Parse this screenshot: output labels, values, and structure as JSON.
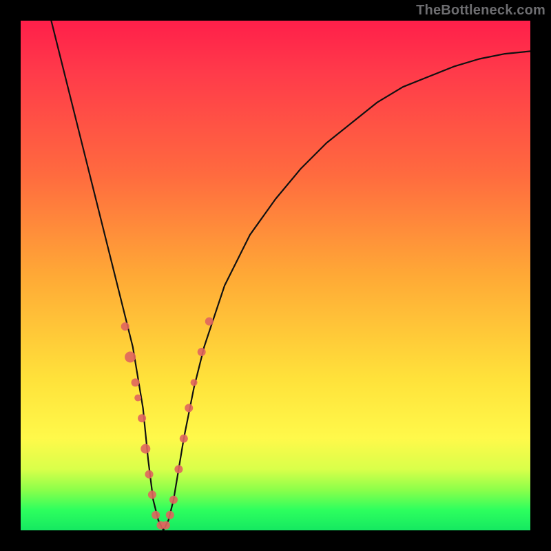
{
  "watermark": "TheBottleneck.com",
  "colors": {
    "gradient_top": "#ff1f4a",
    "gradient_bottom": "#15e861",
    "curve": "#111111",
    "marker": "#e0655e",
    "frame": "#000000"
  },
  "chart_data": {
    "type": "line",
    "title": "",
    "xlabel": "",
    "ylabel": "",
    "xlim": [
      0,
      100
    ],
    "ylim": [
      0,
      100
    ],
    "grid": false,
    "legend": false,
    "series": [
      {
        "name": "curve",
        "x": [
          6,
          8,
          10,
          12,
          14,
          16,
          18,
          20,
          22,
          24,
          25,
          26,
          27,
          28,
          29,
          30,
          32,
          34,
          36,
          40,
          45,
          50,
          55,
          60,
          65,
          70,
          75,
          80,
          85,
          90,
          95,
          100
        ],
        "y": [
          100,
          92,
          84,
          76,
          68,
          60,
          52,
          44,
          36,
          24,
          14,
          6,
          2,
          0,
          2,
          6,
          18,
          28,
          36,
          48,
          58,
          65,
          71,
          76,
          80,
          84,
          87,
          89,
          91,
          92.5,
          93.5,
          94
        ]
      }
    ],
    "markers": [
      {
        "x": 20.5,
        "y": 40,
        "r": 6
      },
      {
        "x": 21.5,
        "y": 34,
        "r": 8
      },
      {
        "x": 22.5,
        "y": 29,
        "r": 6
      },
      {
        "x": 23.0,
        "y": 26,
        "r": 5
      },
      {
        "x": 23.8,
        "y": 22,
        "r": 6
      },
      {
        "x": 24.5,
        "y": 16,
        "r": 7
      },
      {
        "x": 25.2,
        "y": 11,
        "r": 6
      },
      {
        "x": 25.8,
        "y": 7,
        "r": 6
      },
      {
        "x": 26.5,
        "y": 3,
        "r": 6
      },
      {
        "x": 27.5,
        "y": 1,
        "r": 6
      },
      {
        "x": 28.5,
        "y": 1,
        "r": 6
      },
      {
        "x": 29.3,
        "y": 3,
        "r": 6
      },
      {
        "x": 30.0,
        "y": 6,
        "r": 6
      },
      {
        "x": 31.0,
        "y": 12,
        "r": 6
      },
      {
        "x": 32.0,
        "y": 18,
        "r": 6
      },
      {
        "x": 33.0,
        "y": 24,
        "r": 6
      },
      {
        "x": 34.0,
        "y": 29,
        "r": 5
      },
      {
        "x": 35.5,
        "y": 35,
        "r": 6
      },
      {
        "x": 37.0,
        "y": 41,
        "r": 6
      }
    ]
  }
}
